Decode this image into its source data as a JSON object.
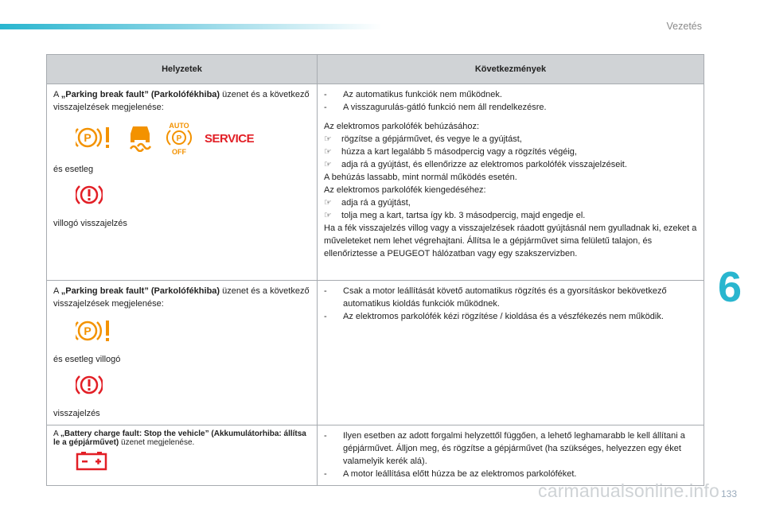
{
  "header": {
    "section": "Vezetés"
  },
  "chapter": "6",
  "page_number": "133",
  "watermark": "carmanualsonline.info",
  "table": {
    "col1_header": "Helyzetek",
    "col2_header": "Következmények",
    "rows": [
      {
        "msg_prefix": "A ",
        "msg_bold": "„Parking break fault” (Parkolófékhiba)",
        "msg_suffix": " üzenet és a következő visszajelzések megjelenése:",
        "service_text": "SERVICE",
        "auto_off_top": "AUTO",
        "auto_off_bottom": "OFF",
        "and_maybe": "és esetleg",
        "flashing": "villogó visszajelzés",
        "consequences_dash": [
          "Az automatikus funkciók nem működnek.",
          "A visszagurulás-gátló funkció nem áll rendelkezésre."
        ],
        "apply_title": "Az elektromos parkolófék behúzásához:",
        "apply_steps": [
          "rögzítse a gépjárművet, és vegye le a gyújtást,",
          "húzza a kart legalább 5 másodpercig vagy a rögzítés végéig,",
          "adja rá a gyújtást, és ellenőrizze az elektromos parkolófék visszajelzéseit."
        ],
        "slow_note": "A behúzás lassabb, mint normál működés esetén.",
        "release_title": "Az elektromos parkolófék kiengedéséhez:",
        "release_steps": [
          "adja rá a gyújtást,",
          "tolja meg a kart, tartsa így kb. 3 másodpercig, majd engedje el."
        ],
        "final_note": "Ha a fék visszajelzés villog vagy a visszajelzések ráadott gyújtásnál nem gyulladnak ki, ezeket a műveleteket nem lehet végrehajtani. Állítsa le a gépjárművet sima felületű talajon, és ellenőriztesse a PEUGEOT hálózatban vagy egy szakszervizben."
      },
      {
        "msg_prefix": "A ",
        "msg_bold": "„Parking break fault” (Parkolófékhiba)",
        "msg_suffix": " üzenet és a következő visszajelzések megjelenése:",
        "and_maybe": "és esetleg villogó",
        "flashing": "visszajelzés",
        "consequences_dash": [
          "Csak a motor leállítását követő automatikus rögzítés és a gyorsításkor bekövetkező automatikus kioldás funkciók működnek.",
          "Az elektromos parkolófék kézi rögzítése / kioldása és a vészfékezés nem működik."
        ]
      },
      {
        "msg_prefix": "A ",
        "msg_bold": "„Battery charge fault: Stop the vehicle” (Akkumulátorhiba: állítsa le a gépjárművet)",
        "msg_suffix": " üzenet megjelenése.",
        "consequences_dash": [
          "Ilyen esetben az adott forgalmi helyzettől függően, a lehető leghamarabb le kell állítani a gépjárművet. Álljon meg, és rögzítse a gépjárművet (ha szükséges, helyezzen egy éket valamelyik kerék alá).",
          "A motor leállítása előtt húzza be az elektromos parkolóféket."
        ]
      }
    ]
  },
  "colors": {
    "accent": "#29b6cf",
    "warning_red": "#e21f26",
    "warning_orange": "#f39200",
    "header_bg": "#d0d3d6"
  },
  "icons": [
    "parking-fault-icon",
    "esp-skid-icon",
    "auto-p-off-icon",
    "service-text-icon",
    "brake-warning-icon",
    "battery-icon"
  ]
}
